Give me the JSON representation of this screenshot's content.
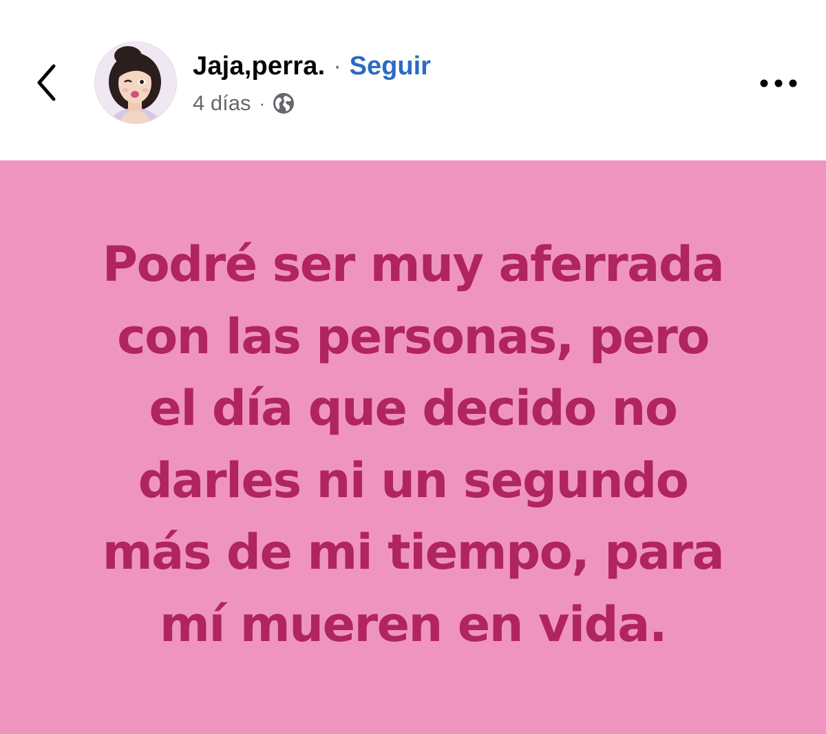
{
  "post": {
    "author_name": "Jaja,perra.",
    "separator": "·",
    "follow_label": "Seguir",
    "time": "4 días",
    "meta_separator": "·",
    "audience_icon": "globe-icon",
    "back_icon": "chevron-left-icon",
    "more_icon": "more-horizontal-icon",
    "background_color": "#ef94bf",
    "text_color": "#b0245f",
    "lines": [
      "Podré ser muy aferrada",
      "con las personas, pero",
      "el día que decido no",
      "darles ni un segundo",
      "más de mi tiempo, para",
      "mí mueren en vida."
    ]
  }
}
